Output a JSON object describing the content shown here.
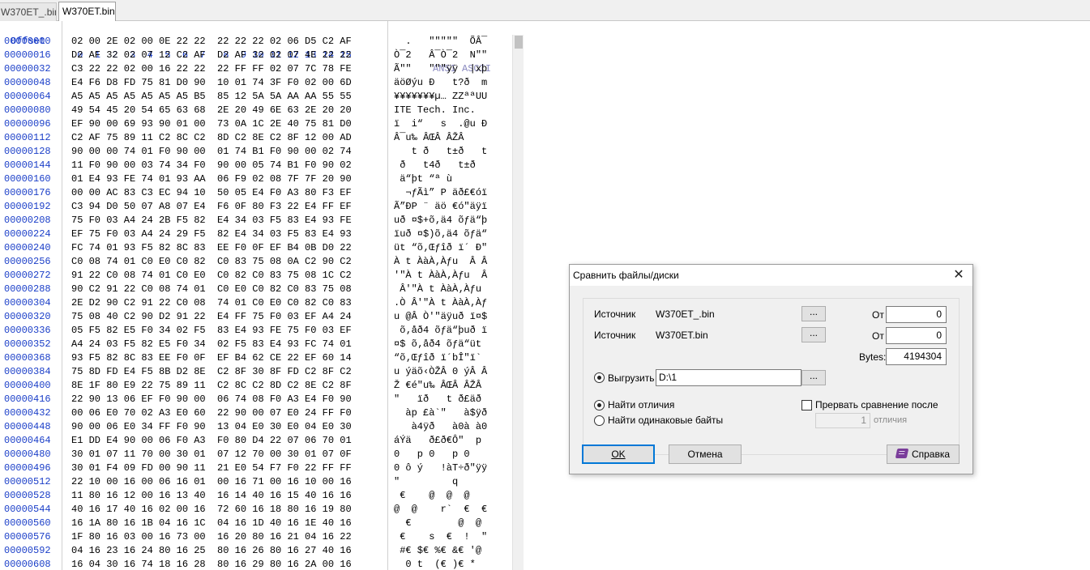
{
  "tabs": [
    "W370ET_.bin",
    "W370ET.bin"
  ],
  "hex": {
    "offset_header": "Offset",
    "column_header": " 0  1  2  3  4  5  6  7   8  9 10 11 12 13 14 15",
    "ansi_header": "ANSI ASCII",
    "rows": [
      {
        "off": "00000000",
        "hex": "02 00 2E 02 00 0E 22 22  22 22 22 02 06 D5 C2 AF",
        "asc": "  .   \"\"\"\"\"  ÕÂ¯"
      },
      {
        "off": "00000016",
        "hex": "D2 AF 32 02 07 12 C2 AF  D2 AF 32 02 07 4E 22 22",
        "asc": "Ò¯2   Â¯Ò¯2  N\"\""
      },
      {
        "off": "00000032",
        "hex": "C3 22 22 02 00 16 22 22  22 FF FF 02 07 7C 78 FE",
        "asc": "Ã\"\"   \"\"\"ÿÿ  |xþ"
      },
      {
        "off": "00000048",
        "hex": "E4 F6 D8 FD 75 81 D0 90  10 01 74 3F F0 02 00 6D",
        "asc": "äöØýu Ð   t?ð  m"
      },
      {
        "off": "00000064",
        "hex": "A5 A5 A5 A5 A5 A5 A5 B5  85 12 5A 5A AA AA 55 55",
        "asc": "¥¥¥¥¥¥¥µ… ZZªªUU"
      },
      {
        "off": "00000080",
        "hex": "49 54 45 20 54 65 63 68  2E 20 49 6E 63 2E 20 20",
        "asc": "ITE Tech. Inc.  "
      },
      {
        "off": "00000096",
        "hex": "EF 90 00 69 93 90 01 00  73 0A 1C 2E 40 75 81 D0",
        "asc": "ï  i“   s  .@u Ð"
      },
      {
        "off": "00000112",
        "hex": "C2 AF 75 89 11 C2 8C C2  8D C2 8E C2 8F 12 00 AD",
        "asc": "Â¯u‰ ÂŒÂ ÂŽÂ    "
      },
      {
        "off": "00000128",
        "hex": "90 00 00 74 01 F0 90 00  01 74 B1 F0 90 00 02 74",
        "asc": "   t ð   t±ð   t"
      },
      {
        "off": "00000144",
        "hex": "11 F0 90 00 03 74 34 F0  90 00 05 74 B1 F0 90 02",
        "asc": " ð   t4ð   t±ð  "
      },
      {
        "off": "00000160",
        "hex": "01 E4 93 FE 74 01 93 AA  06 F9 02 08 7F 7F 20 90",
        "asc": " ä“þt “ª ù      "
      },
      {
        "off": "00000176",
        "hex": "00 00 AC 83 C3 EC 94 10  50 05 E4 F0 A3 80 F3 EF",
        "asc": "  ¬ƒÃì” P äð£€óï"
      },
      {
        "off": "00000192",
        "hex": "C3 94 D0 50 07 A8 07 E4  F6 0F 80 F3 22 E4 FF EF",
        "asc": "Ã”ÐP ¨ äö €ó\"äÿï"
      },
      {
        "off": "00000208",
        "hex": "75 F0 03 A4 24 2B F5 82  E4 34 03 F5 83 E4 93 FE",
        "asc": "uð ¤$+õ‚ä4 õƒä“þ"
      },
      {
        "off": "00000224",
        "hex": "EF 75 F0 03 A4 24 29 F5  82 E4 34 03 F5 83 E4 93",
        "asc": "ïuð ¤$)õ‚ä4 õƒä“"
      },
      {
        "off": "00000240",
        "hex": "FC 74 01 93 F5 82 8C 83  EE F0 0F EF B4 0B D0 22",
        "asc": "üt “õ‚Œƒîð ï´ Ð\""
      },
      {
        "off": "00000256",
        "hex": "C0 08 74 01 C0 E0 C0 82  C0 83 75 08 0A C2 90 C2",
        "asc": "À t ÀàÀ‚Àƒu  Â Â"
      },
      {
        "off": "00000272",
        "hex": "91 22 C0 08 74 01 C0 E0  C0 82 C0 83 75 08 1C C2",
        "asc": "'\"À t ÀàÀ‚Àƒu  Â"
      },
      {
        "off": "00000288",
        "hex": "90 C2 91 22 C0 08 74 01  C0 E0 C0 82 C0 83 75 08",
        "asc": " Â'\"À t ÀàÀ‚Àƒu "
      },
      {
        "off": "00000304",
        "hex": "2E D2 90 C2 91 22 C0 08  74 01 C0 E0 C0 82 C0 83",
        "asc": ".Ò Â'\"À t ÀàÀ‚Àƒ"
      },
      {
        "off": "00000320",
        "hex": "75 08 40 C2 90 D2 91 22  E4 FF 75 F0 03 EF A4 24",
        "asc": "u @Â Ò'\"äÿuð ï¤$"
      },
      {
        "off": "00000336",
        "hex": "05 F5 82 E5 F0 34 02 F5  83 E4 93 FE 75 F0 03 EF",
        "asc": " õ‚åð4 õƒä“þuð ï"
      },
      {
        "off": "00000352",
        "hex": "A4 24 03 F5 82 E5 F0 34  02 F5 83 E4 93 FC 74 01",
        "asc": "¤$ õ‚åð4 õƒä“üt "
      },
      {
        "off": "00000368",
        "hex": "93 F5 82 8C 83 EE F0 0F  EF B4 62 CE 22 EF 60 14",
        "asc": "“õ‚Œƒîð ï´bÎ\"ï` "
      },
      {
        "off": "00000384",
        "hex": "75 8D FD E4 F5 8B D2 8E  C2 8F 30 8F FD C2 8F C2",
        "asc": "u ýäõ‹ÒŽÂ 0 ýÂ Â"
      },
      {
        "off": "00000400",
        "hex": "8E 1F 80 E9 22 75 89 11  C2 8C C2 8D C2 8E C2 8F",
        "asc": "Ž €é\"u‰ ÂŒÂ ÂŽÂ "
      },
      {
        "off": "00000416",
        "hex": "22 90 13 06 EF F0 90 00  06 74 08 F0 A3 E4 F0 90",
        "asc": "\"   ïð   t ð£äð "
      },
      {
        "off": "00000432",
        "hex": "00 06 E0 70 02 A3 E0 60  22 90 00 07 E0 24 FF F0",
        "asc": "  àp £à`\"   à$ÿð"
      },
      {
        "off": "00000448",
        "hex": "90 00 06 E0 34 FF F0 90  13 04 E0 30 E0 04 E0 30",
        "asc": "   à4ÿð   à0à à0"
      },
      {
        "off": "00000464",
        "hex": "E1 DD E4 90 00 06 F0 A3  F0 80 D4 22 07 06 70 01",
        "asc": "áÝä   ð£ð€Ô\"  p "
      },
      {
        "off": "00000480",
        "hex": "30 01 07 11 70 00 30 01  07 12 70 00 30 01 07 0F",
        "asc": "0   p 0   p 0   "
      },
      {
        "off": "00000496",
        "hex": "30 01 F4 09 FD 00 90 11  21 E0 54 F7 F0 22 FF FF",
        "asc": "0 ô ý   !àT÷ð\"ÿÿ"
      },
      {
        "off": "00000512",
        "hex": "22 10 00 16 00 06 16 01  00 16 71 00 16 10 00 16",
        "asc": "\"         q     "
      },
      {
        "off": "00000528",
        "hex": "11 80 16 12 00 16 13 40  16 14 40 16 15 40 16 16",
        "asc": " €    @  @  @   "
      },
      {
        "off": "00000544",
        "hex": "40 16 17 40 16 02 00 16  72 60 16 18 80 16 19 80",
        "asc": "@  @    r`  €  €"
      },
      {
        "off": "00000560",
        "hex": "16 1A 80 16 1B 04 16 1C  04 16 1D 40 16 1E 40 16",
        "asc": "  €        @  @ "
      },
      {
        "off": "00000576",
        "hex": "1F 80 16 03 00 16 73 00  16 20 80 16 21 04 16 22",
        "asc": " €    s  €  !  \""
      },
      {
        "off": "00000592",
        "hex": "04 16 23 16 24 80 16 25  80 16 26 80 16 27 40 16",
        "asc": " #€ $€ %€ &€ '@ "
      },
      {
        "off": "00000608",
        "hex": "16 04 30 16 74 18 16 28  80 16 29 80 16 2A 00 16",
        "asc": "  0 t  (€ )€ *  "
      }
    ]
  },
  "dialog": {
    "title": "Сравнить файлы/диски",
    "close": "✕",
    "source_label": "Источник",
    "source1_file": "W370ET_.bin",
    "source2_file": "W370ET.bin",
    "browse": "...",
    "from_label": "От",
    "from1_value": "0",
    "from2_value": "0",
    "bytes_label": "Bytes:",
    "bytes_value": "4194304",
    "export_label": "Выгрузить",
    "export_path": "D:\\1",
    "find_diff_label": "Найти отличия",
    "find_same_label": "Найти одинаковые байты",
    "abort_label": "Прервать сравнение после",
    "abort_count": "1",
    "abort_unit": "отличия",
    "ok_button": "OK",
    "cancel_button": "Отмена",
    "help_button": "Справка"
  }
}
